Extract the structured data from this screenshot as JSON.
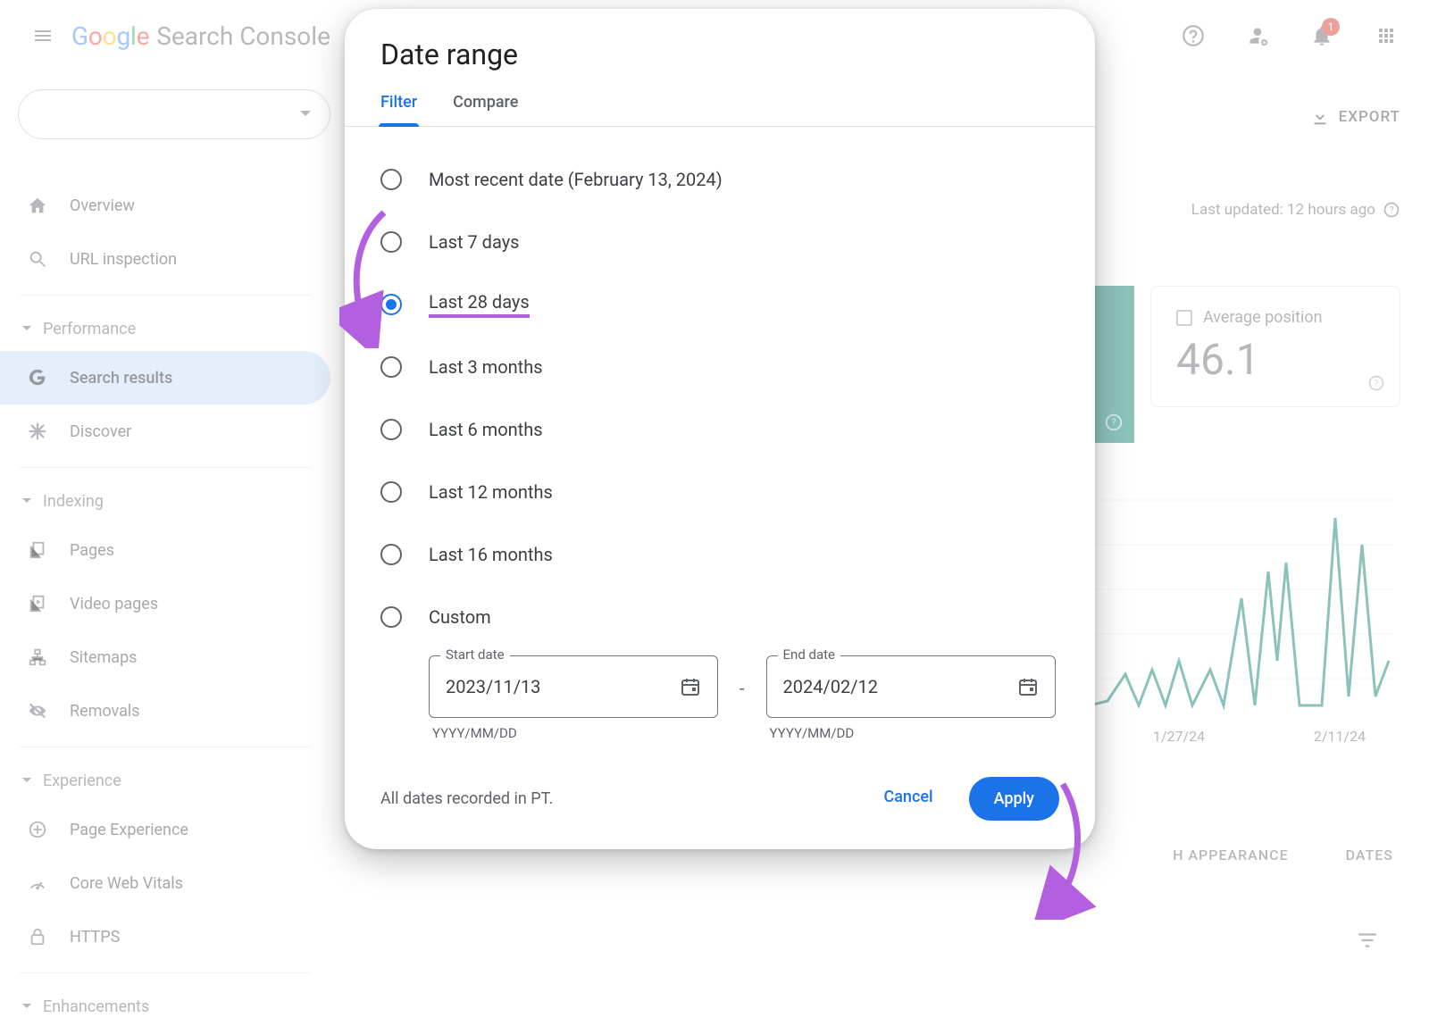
{
  "header": {
    "product_name": "Search Console",
    "notification_count": "1"
  },
  "actions": {
    "export_label": "EXPORT",
    "last_updated_text": "Last updated: 12 hours ago"
  },
  "metric": {
    "label": "Average position",
    "value": "46.1"
  },
  "chart_ticks": [
    "1/27/24",
    "2/11/24"
  ],
  "nav": {
    "overview": "Overview",
    "url_inspection": "URL inspection",
    "section_performance": "Performance",
    "search_results": "Search results",
    "discover": "Discover",
    "section_indexing": "Indexing",
    "pages": "Pages",
    "video_pages": "Video pages",
    "sitemaps": "Sitemaps",
    "removals": "Removals",
    "section_experience": "Experience",
    "page_experience": "Page Experience",
    "core_web_vitals": "Core Web Vitals",
    "https": "HTTPS",
    "section_enhancements": "Enhancements"
  },
  "tabs_row": {
    "search_appearance": "H APPEARANCE",
    "dates": "DATES"
  },
  "dialog": {
    "title": "Date range",
    "tab_filter": "Filter",
    "tab_compare": "Compare",
    "options": {
      "most_recent": "Most recent date (February 13, 2024)",
      "last7": "Last 7 days",
      "last28": "Last 28 days",
      "last3m": "Last 3 months",
      "last6m": "Last 6 months",
      "last12m": "Last 12 months",
      "last16m": "Last 16 months",
      "custom": "Custom"
    },
    "start_label": "Start date",
    "end_label": "End date",
    "start_value": "2023/11/13",
    "end_value": "2024/02/12",
    "date_hint": "YYYY/MM/DD",
    "tz_note": "All dates recorded in PT.",
    "cancel": "Cancel",
    "apply": "Apply"
  },
  "colors": {
    "accent": "#1a73e8",
    "annotation": "#b260df",
    "teal": "#00796b"
  }
}
